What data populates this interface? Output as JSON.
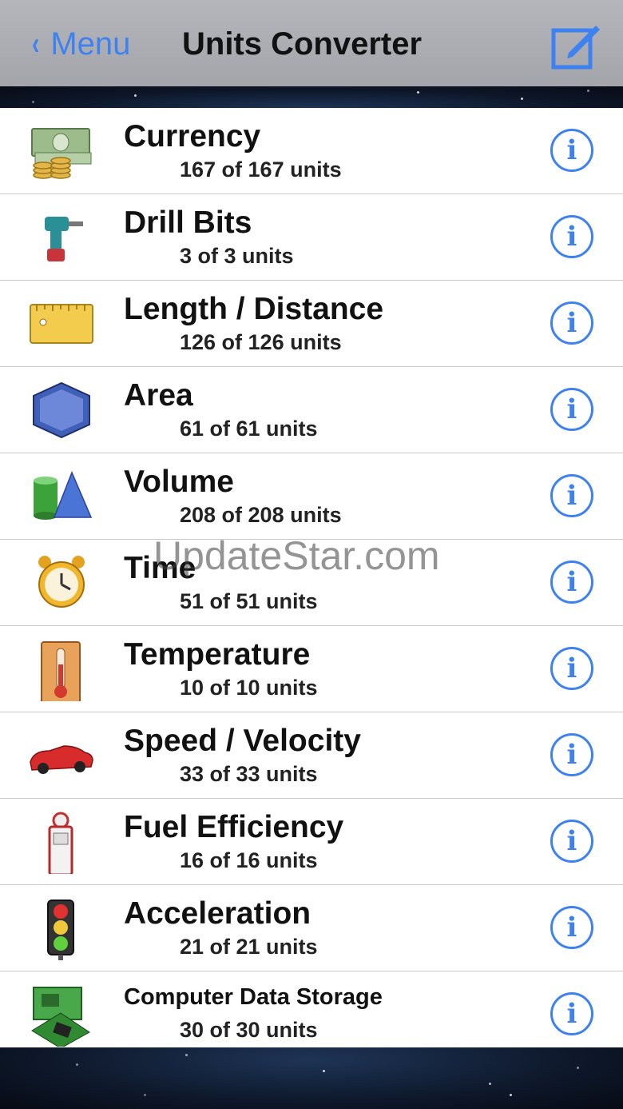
{
  "navbar": {
    "back_label": "Menu",
    "title": "Units Converter",
    "accent_color": "#3d82f0"
  },
  "categories": [
    {
      "title": "Currency",
      "units": "167 of 167 units",
      "icon": "currency-icon"
    },
    {
      "title": "Drill Bits",
      "units": "3 of 3 units",
      "icon": "drill-icon"
    },
    {
      "title": "Length / Distance",
      "units": "126 of 126 units",
      "icon": "ruler-icon"
    },
    {
      "title": "Area",
      "units": "61 of 61 units",
      "icon": "hexagon-icon"
    },
    {
      "title": "Volume",
      "units": "208 of 208 units",
      "icon": "cylinder-cone-icon"
    },
    {
      "title": "Time",
      "units": "51 of 51 units",
      "icon": "alarm-clock-icon"
    },
    {
      "title": "Temperature",
      "units": "10 of 10 units",
      "icon": "thermometer-icon"
    },
    {
      "title": "Speed / Velocity",
      "units": "33 of 33 units",
      "icon": "car-icon"
    },
    {
      "title": "Fuel Efficiency",
      "units": "16 of 16 units",
      "icon": "fuel-pump-icon"
    },
    {
      "title": "Acceleration",
      "units": "21 of 21 units",
      "icon": "traffic-light-icon"
    },
    {
      "title": "Computer Data Storage",
      "units": "30 of 30 units",
      "icon": "circuit-board-icon"
    }
  ],
  "info_glyph": "i",
  "watermark": "UpdateStar.com"
}
